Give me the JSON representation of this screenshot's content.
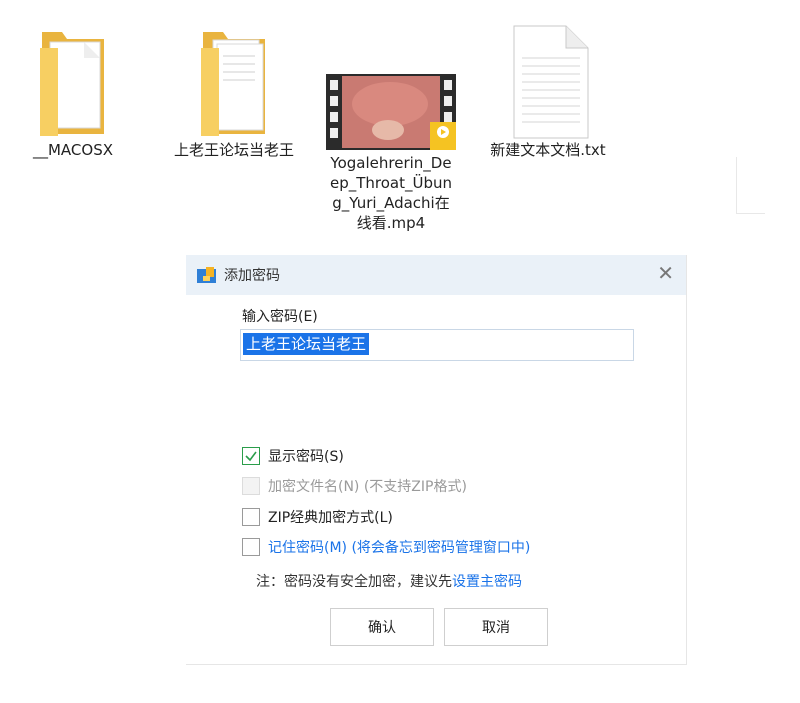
{
  "desktop": {
    "files": [
      {
        "name": "__MACOSX",
        "type": "folder"
      },
      {
        "name": "上老王论坛当老王",
        "type": "folder"
      },
      {
        "name": "Yogalehrerin_Deep_Throat_Übung_Yuri_Adachi在线看.mp4",
        "type": "video",
        "badge": "Player"
      },
      {
        "name": "新建文本文档.txt",
        "type": "text"
      }
    ]
  },
  "dialog": {
    "title": "添加密码",
    "password_label": "输入密码(E)",
    "password_value": "上老王论坛当老王",
    "options": [
      {
        "label": "显示密码(S)",
        "checked": true,
        "disabled": false
      },
      {
        "label": "加密文件名(N) (不支持ZIP格式)",
        "checked": false,
        "disabled": true
      },
      {
        "label": "ZIP经典加密方式(L)",
        "checked": false,
        "disabled": false
      },
      {
        "label": "记住密码(M) (将会备忘到密码管理窗口中)",
        "checked": false,
        "disabled": false
      }
    ],
    "note_prefix": "注：密码没有安全加密，建议先",
    "note_link": "设置主密码",
    "ok_label": "确认",
    "cancel_label": "取消"
  },
  "colors": {
    "accent": "#1a73e8",
    "check": "#2a9d4a",
    "titlebar": "#eaf1f8",
    "folder": "#f6c855"
  }
}
